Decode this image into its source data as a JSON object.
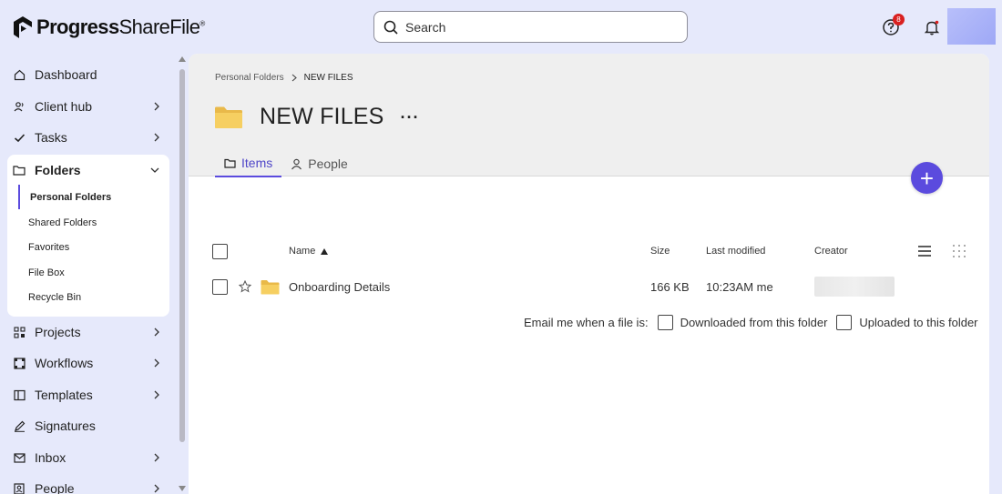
{
  "brand": {
    "name_bold": "Progress",
    "name_regular": "ShareFile",
    "mark": "®"
  },
  "search": {
    "placeholder": "Search"
  },
  "header": {
    "help_badge_count": "8"
  },
  "sidebar": {
    "items": [
      {
        "label": "Dashboard",
        "icon": "home-icon"
      },
      {
        "label": "Client hub",
        "icon": "people-icon"
      },
      {
        "label": "Tasks",
        "icon": "check-icon"
      },
      {
        "label": "Folders",
        "icon": "folder-icon"
      },
      {
        "label": "Projects",
        "icon": "projects-icon"
      },
      {
        "label": "Workflows",
        "icon": "workflow-icon"
      },
      {
        "label": "Templates",
        "icon": "template-icon"
      },
      {
        "label": "Signatures",
        "icon": "pen-icon"
      },
      {
        "label": "Inbox",
        "icon": "inbox-icon"
      },
      {
        "label": "People",
        "icon": "contact-icon"
      }
    ],
    "folders_sub": [
      "Personal Folders",
      "Shared Folders",
      "Favorites",
      "File Box",
      "Recycle Bin"
    ]
  },
  "breadcrumb": {
    "parent": "Personal Folders",
    "current": "NEW FILES"
  },
  "page": {
    "title": "NEW FILES"
  },
  "tabs": [
    {
      "label": "Items"
    },
    {
      "label": "People"
    }
  ],
  "table": {
    "headers": {
      "name": "Name",
      "size": "Size",
      "modified": "Last modified",
      "creator": "Creator"
    },
    "rows": [
      {
        "name": "Onboarding Details",
        "size": "166 KB",
        "modified": "10:23AM me"
      }
    ]
  },
  "email": {
    "label": "Email me when a file is:",
    "option_downloaded": "Downloaded from this folder",
    "option_uploaded": "Uploaded to this folder"
  },
  "colors": {
    "accent": "#5b4bde",
    "folder": "#f2c94c",
    "badge": "#d92020",
    "background": "#e6e9fb"
  }
}
